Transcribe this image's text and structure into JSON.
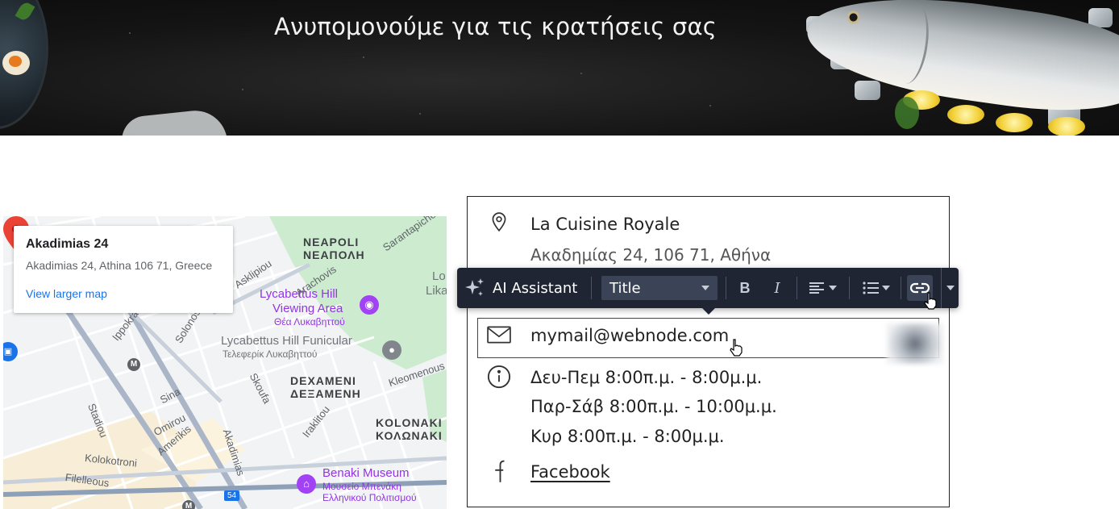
{
  "hero": {
    "title": "Ανυπομονούμε για τις κρατήσεις σας"
  },
  "map": {
    "card": {
      "title": "Akadimias 24",
      "address": "Akadimias 24, Athina 106 71, Greece",
      "link": "View larger map"
    },
    "labels": {
      "neapoli_en": "NEAPOLI",
      "neapoli_gr": "ΝΕΑΠΟΛΗ",
      "sarantapichou": "Sarantapichou",
      "lo": "Lo",
      "lika": "Lika",
      "asklipiou": "Asklipiou",
      "arachovis": "Arachovis",
      "lycabettus_viewing_1": "Lycabettus Hill",
      "lycabettus_viewing_2": "Viewing Area",
      "lycabettus_viewing_gr": "Θέα Λυκαβηττού",
      "ippokratous": "Ippokrat",
      "solonos": "Solonos",
      "funicular": "Lycabettus Hill Funicular",
      "funicular_gr": "Τελεφερίκ Λυκαβηττού",
      "stadiou": "Stadiou",
      "sina": "Sina",
      "skoufa": "Skoufa",
      "dexameni_en": "DEXAMENI",
      "dexameni_gr": "ΔΕΞΑΜΕΝΗ",
      "kleomenous": "Kleomenous",
      "omirou": "Omirou",
      "amerikis": "Amerikis",
      "akadimias": "Akadimias",
      "iraklitou": "Iraklitou",
      "kolonaki_en": "KOLONAKI",
      "kolonaki_gr": "ΚΟΛΩΝΑΚΙ",
      "kolokotroni": "Kolokotroni",
      "benaki": "Benaki Museum",
      "benaki_gr1": "Μουσείο Μπενάκη",
      "benaki_gr2": "Ελληνικού Πολιτισμού",
      "filelinon": "Filelleous",
      "ptopos": "Pl",
      "m1": "M",
      "m2": "M",
      "road54": "54"
    }
  },
  "contact": {
    "name": "La Cuisine Royale",
    "address": "Ακαδημίας 24, 106 71, Αθήνα",
    "email": "mymail@webnode.com",
    "hours": [
      "Δευ-Πεμ  8:00π.μ. - 8:00μ.μ.",
      "Παρ-Σάβ  8:00π.μ. - 10:00μ.μ.",
      "Κυρ  8:00π.μ. - 8:00μ.μ."
    ],
    "social": "Facebook"
  },
  "toolbar": {
    "ai": "AI Assistant",
    "style": "Title",
    "bold": "B",
    "italic": "I"
  },
  "icons": {
    "ai": "sparkle-icon",
    "location": "location-pin-icon",
    "email": "envelope-icon",
    "info": "info-icon",
    "facebook": "facebook-icon"
  },
  "colors": {
    "toolbar_bg": "#1f2533",
    "map_pin": "#ea4335",
    "link_blue": "#1a73e8",
    "poi_purple": "#9334e6"
  }
}
